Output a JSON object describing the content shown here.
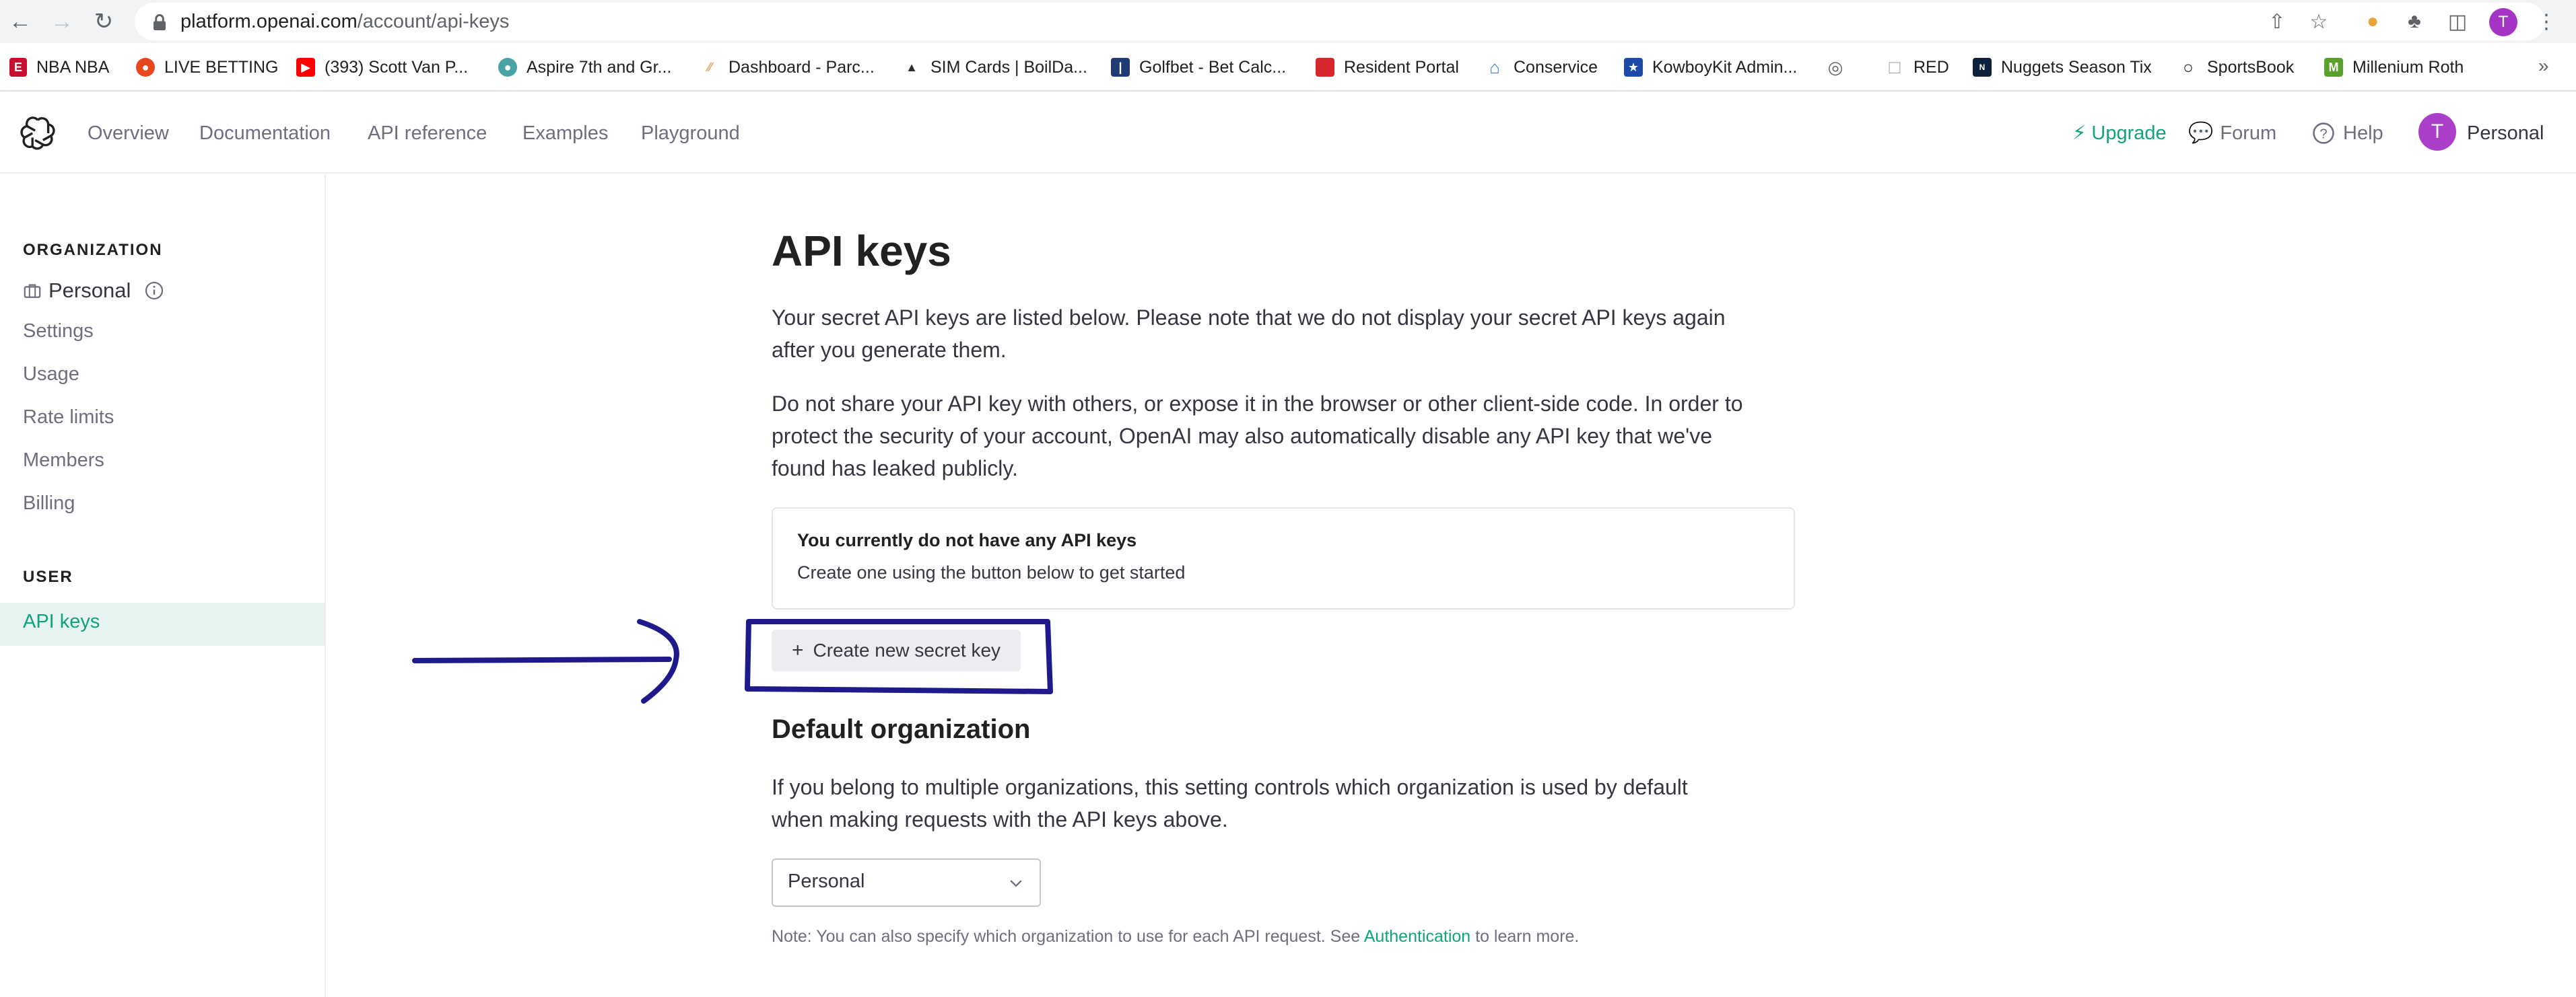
{
  "browser": {
    "url_host": "platform.openai.com",
    "url_path": "/account/api-keys",
    "profile_initial": "T",
    "bookmarks": [
      {
        "label": "NBA NBA",
        "icon": "nba-icon",
        "color": "#c8102e"
      },
      {
        "label": "LIVE BETTING",
        "icon": "football-icon",
        "color": "#e8461d"
      },
      {
        "label": "(393) Scott Van P...",
        "icon": "youtube-icon",
        "color": "#ff0000"
      },
      {
        "label": "Aspire 7th and Gr...",
        "icon": "globe-icon",
        "color": "#4aa3a2"
      },
      {
        "label": "Dashboard - Parc...",
        "icon": "parcel-icon",
        "color": "#e0a45a"
      },
      {
        "label": "SIM Cards | BoilDa...",
        "icon": "drop-icon",
        "color": "#2b2b2b"
      },
      {
        "label": "Golfbet - Bet Calc...",
        "icon": "pga-icon",
        "color": "#1f3b73"
      },
      {
        "label": "Resident Portal",
        "icon": "square-icon",
        "color": "#d8262e"
      },
      {
        "label": "Conservice",
        "icon": "house-icon",
        "color": "#2a7bd8"
      },
      {
        "label": "KowboyKit Admin...",
        "icon": "shield-icon",
        "color": "#1b4aa8"
      },
      {
        "label": "",
        "icon": "world-icon",
        "color": "#5f6368"
      },
      {
        "label": "RED",
        "icon": "page-icon",
        "color": "#9aa0a6"
      },
      {
        "label": "Nuggets Season Tix",
        "icon": "nuggets-icon",
        "color": "#0e2240"
      },
      {
        "label": "SportsBook",
        "icon": "ball-icon",
        "color": "#202124"
      },
      {
        "label": "Millenium Roth",
        "icon": "m-icon",
        "color": "#5aa02c"
      }
    ]
  },
  "header": {
    "nav": [
      "Overview",
      "Documentation",
      "API reference",
      "Examples",
      "Playground"
    ],
    "upgrade": "Upgrade",
    "forum": "Forum",
    "help": "Help",
    "account_initial": "T",
    "account": "Personal"
  },
  "sidebar": {
    "org_title": "ORGANIZATION",
    "org_name": "Personal",
    "org_items": [
      "Settings",
      "Usage",
      "Rate limits",
      "Members",
      "Billing"
    ],
    "user_title": "USER",
    "user_items": [
      "API keys"
    ]
  },
  "main": {
    "title": "API keys",
    "para1_line1": "Your secret API keys are listed below. Please note that we do not display your secret API keys again",
    "para1_line2": "after you generate them.",
    "para2_line1": "Do not share your API key with others, or expose it in the browser or other client-side code. In order to",
    "para2_line2": "protect the security of your account, OpenAI may also automatically disable any API key that we've",
    "para2_line3": "found has leaked publicly.",
    "empty_title": "You currently do not have any API keys",
    "empty_sub": "Create one using the button below to get started",
    "create_button": "Create new secret key",
    "default_org_title": "Default organization",
    "default_org_line1": "If you belong to multiple organizations, this setting controls which organization is used by default",
    "default_org_line2": "when making requests with the API keys above.",
    "org_select_value": "Personal",
    "note_prefix": "Note: You can also specify which organization to use for each API request. See ",
    "note_link": "Authentication",
    "note_suffix": " to learn more."
  },
  "colors": {
    "accent": "#10a37f",
    "annotation": "#1e1a8c"
  }
}
